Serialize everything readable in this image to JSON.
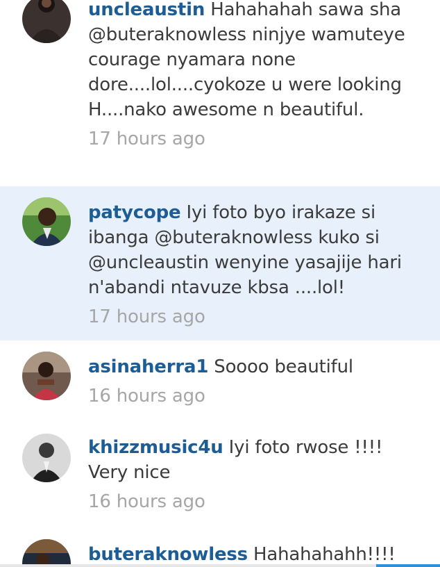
{
  "colors": {
    "username": "#1d5d96",
    "text": "#3b3b3b",
    "timestamp": "#a6a6a6",
    "highlight_background": "#e8f1fb",
    "accent": "#2f8fd8"
  },
  "comments": [
    {
      "username": "uncleaustin",
      "text": " Hahahahah sawa sha @buteraknowless ninjye wamuteye courage nyamara none dore....lol....cyokoze u were looking H....nako awesome n beautiful.",
      "time": "17 hours ago",
      "avatar_icon": "profile-photo-icon"
    },
    {
      "username": "patycope",
      "text": " Iyi foto byo irakaze si ibanga @buteraknowless kuko si @uncleaustin wenyine yasajije hari n'abandi ntavuze kbsa ....lol!",
      "time": "17 hours ago",
      "avatar_icon": "profile-photo-icon"
    },
    {
      "username": "asinaherra1",
      "text": " Soooo beautiful",
      "time": "16 hours ago",
      "avatar_icon": "profile-photo-icon"
    },
    {
      "username": "khizzmusic4u",
      "text": " Iyi foto rwose !!!! Very nice",
      "time": "16 hours ago",
      "avatar_icon": "profile-photo-icon"
    },
    {
      "username": "buteraknowless",
      "text": " Hahahahahh!!!!",
      "time": "",
      "avatar_icon": "profile-photo-icon"
    }
  ]
}
